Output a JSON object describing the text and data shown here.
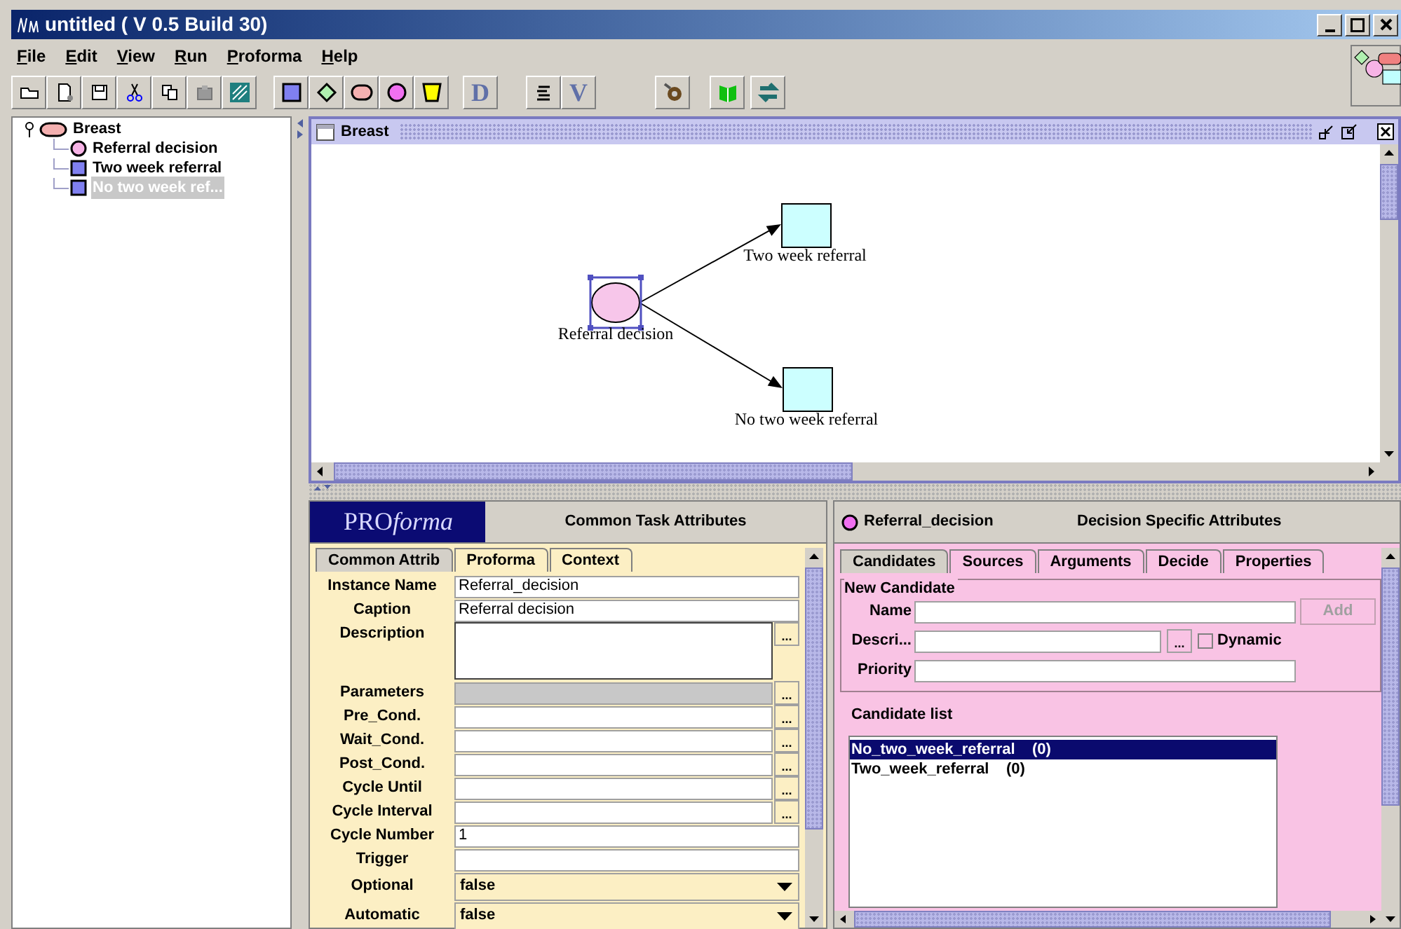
{
  "window": {
    "title": "untitled ( V 0.5 Build 30)"
  },
  "menu": [
    {
      "label": "File"
    },
    {
      "label": "Edit"
    },
    {
      "label": "View"
    },
    {
      "label": "Run"
    },
    {
      "label": "Proforma"
    },
    {
      "label": "Help"
    }
  ],
  "toolbar": {
    "letter_buttons": [
      "D",
      "V"
    ]
  },
  "tree": {
    "label": "Breast",
    "kind": "plan",
    "expanded": true,
    "selected": false,
    "children": [
      {
        "label": "Referral decision",
        "kind": "decision",
        "selected": false
      },
      {
        "label": "Two week referral",
        "kind": "action",
        "selected": false
      },
      {
        "label": "No two week ref...",
        "kind": "action",
        "selected": true
      }
    ]
  },
  "diagram": {
    "title": "Breast",
    "nodes": [
      {
        "label": "Referral decision",
        "kind": "decision",
        "selected": true
      },
      {
        "label": "Two week referral",
        "kind": "action",
        "selected": false
      },
      {
        "label": "No two week referral",
        "kind": "action",
        "selected": false
      }
    ]
  },
  "common_panel": {
    "logo": {
      "upright": "PRO",
      "italic": "forma"
    },
    "title": "Common Task Attributes",
    "tabs": [
      {
        "label": "Common Attrib",
        "selected": true
      },
      {
        "label": "Proforma",
        "selected": false
      },
      {
        "label": "Context",
        "selected": false
      }
    ],
    "fields": [
      {
        "label": "Instance Name",
        "kind": "text",
        "value": "Referral_decision"
      },
      {
        "label": "Caption",
        "kind": "text",
        "value": "Referral decision"
      },
      {
        "label": "Description",
        "kind": "textarea",
        "browse": "..."
      },
      {
        "label": "Parameters",
        "kind": "disabled",
        "browse": "..."
      },
      {
        "label": "Pre_Cond.",
        "kind": "text",
        "browse": "..."
      },
      {
        "label": "Wait_Cond.",
        "kind": "text",
        "browse": "..."
      },
      {
        "label": "Post_Cond.",
        "kind": "text",
        "browse": "..."
      },
      {
        "label": "Cycle Until",
        "kind": "text",
        "browse": "..."
      },
      {
        "label": "Cycle Interval",
        "kind": "text",
        "browse": "..."
      },
      {
        "label": "Cycle Number",
        "kind": "text",
        "value": "1"
      },
      {
        "label": "Trigger",
        "kind": "text"
      },
      {
        "label": "Optional",
        "kind": "select",
        "value": "false"
      },
      {
        "label": "Automatic",
        "kind": "select",
        "value": "false"
      }
    ]
  },
  "decision_panel": {
    "node": "Referral_decision",
    "title": "Decision Specific Attributes",
    "tabs": [
      {
        "label": "Candidates",
        "selected": true
      },
      {
        "label": "Sources",
        "selected": false
      },
      {
        "label": "Arguments",
        "selected": false
      },
      {
        "label": "Decide",
        "selected": false
      },
      {
        "label": "Properties",
        "selected": false
      }
    ],
    "group": "New Candidate",
    "name_label": "Name",
    "add_button": {
      "label": "Add",
      "disabled": true
    },
    "description_label": "Descri...",
    "browse": "...",
    "dynamic": {
      "label": "Dynamic",
      "checked": false
    },
    "priority_label": "Priority",
    "list_label": "Candidate list",
    "candidates": [
      {
        "label": "No_two_week_referral    (0)",
        "selected": true
      },
      {
        "label": "Two_week_referral    (0)",
        "selected": false
      }
    ]
  }
}
